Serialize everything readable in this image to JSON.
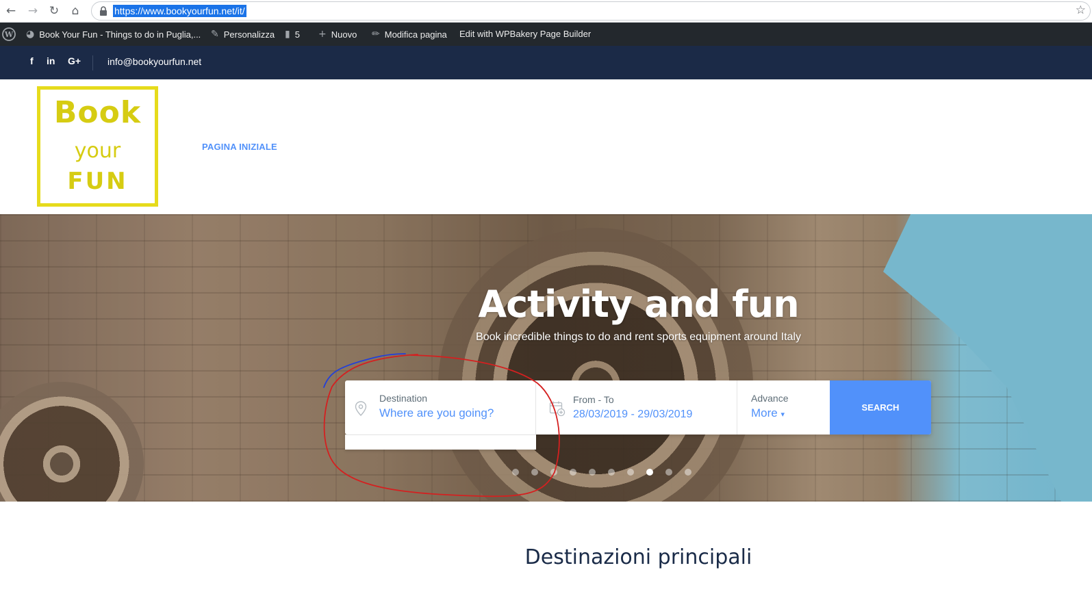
{
  "browser": {
    "url": "https://www.bookyourfun.net/it/",
    "icons": [
      "back-icon",
      "forward-icon",
      "reload-icon",
      "home-icon",
      "lock-icon",
      "star-icon"
    ]
  },
  "wp_admin_bar": {
    "site_name": "Book Your Fun - Things to do in Puglia,...",
    "customize": "Personalizza",
    "comments_count": "5",
    "new": "Nuovo",
    "edit_page": "Modifica pagina",
    "wpbakery": "Edit with WPBakery Page Builder"
  },
  "top_strip": {
    "social": [
      "f",
      "in",
      "G+"
    ],
    "email": "info@bookyourfun.net",
    "bg_color": "#1b2a47"
  },
  "header": {
    "logo_lines": [
      "Book",
      "your",
      "FUN"
    ],
    "logo_color": "#e6db1c",
    "menu": [
      "PAGINA INIZIALE"
    ],
    "accent": "#5191fa"
  },
  "hero": {
    "title": "Activity and fun",
    "subtitle": "Book incredible things to do and rent sports equipment around Italy",
    "search": {
      "destination_label": "Destination",
      "destination_placeholder": "Where are you going?",
      "date_label": "From - To",
      "date_value": "28/03/2019 - 29/03/2019",
      "advance_label": "Advance",
      "advance_value": "More",
      "search_button": "SEARCH"
    },
    "slider_dots": 10,
    "active_dot": 7
  },
  "section": {
    "title": "Destinazioni principali"
  }
}
